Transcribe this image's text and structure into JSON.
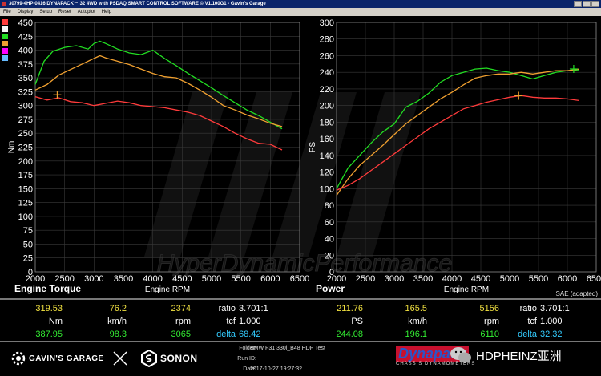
{
  "window": {
    "title": "30799-4HP-0416 DYNAPACK™ 32 4WD with PSDAQ SMART CONTROL SOFTWARE © V1.100G1 - Gavin's Garage",
    "menu": [
      "File",
      "Display",
      "Setup",
      "Reset",
      "Autoplot",
      "Help"
    ]
  },
  "legend_swatches": {
    "colors": [
      "#ff3b3b",
      "#f5f5f5",
      "#22dd22",
      "#f0a030",
      "#ff00ff",
      "#66bbff"
    ]
  },
  "labels": {
    "torque_title": "Engine Torque",
    "power_title": "Power",
    "sae": "SAE (adapted)"
  },
  "watermark": "HyperDynamicPerformance",
  "readout": {
    "torque": {
      "row1": {
        "value": "319.53",
        "speed": "76.2",
        "rpm": "2374"
      },
      "units": {
        "value": "Nm",
        "speed": "km/h",
        "rpm": "rpm"
      },
      "row2": {
        "value": "387.95",
        "speed": "98.3",
        "rpm": "3065"
      }
    },
    "power": {
      "row1": {
        "value": "211.76",
        "speed": "165.5",
        "rpm": "5156"
      },
      "units": {
        "value": "PS",
        "speed": "km/h",
        "rpm": "rpm"
      },
      "row2": {
        "value": "244.08",
        "speed": "196.1",
        "rpm": "6110"
      }
    },
    "torque_info": {
      "ratio_label": "ratio",
      "ratio_value": "3.701:1",
      "tcf_label": "tcf",
      "tcf_value": "1.000",
      "delta_label": "delta",
      "delta_value": "68.42"
    },
    "power_info": {
      "ratio_label": "ratio",
      "ratio_value": "3.701:1",
      "tcf_label": "tcf",
      "tcf_value": "1.000",
      "delta_label": "delta",
      "delta_value": "32.32"
    }
  },
  "footer": {
    "brand1": "GAVIN'S GARAGE",
    "brand2": "SONON",
    "folder_label": "Folder:",
    "folder_value": "BMW F31 330i_B48 HDP Test",
    "runid_label": "Run ID:",
    "runid_value": "",
    "date_label": "Date:",
    "date_value": "2017-10-27 19:27:32",
    "dynapack": "Dynapack",
    "dynapack_sub": "CHASSIS DYNAMOMETERS",
    "wechat": "HDPHEINZ亚洲"
  },
  "chart_data": [
    {
      "type": "line",
      "title": "Engine Torque",
      "xlabel": "Engine RPM",
      "ylabel": "Nm",
      "xlim": [
        2000,
        6500
      ],
      "ylim": [
        0,
        450
      ],
      "xticks": [
        2000,
        2500,
        3000,
        3500,
        4000,
        4500,
        5000,
        5500,
        6000,
        6500
      ],
      "yticks": [
        0,
        25,
        50,
        75,
        100,
        125,
        150,
        175,
        200,
        225,
        250,
        275,
        300,
        325,
        350,
        375,
        400,
        425,
        450
      ],
      "grid": true,
      "series": [
        {
          "color": "#22dd22",
          "x": [
            2000,
            2150,
            2300,
            2500,
            2700,
            2900,
            3000,
            3100,
            3200,
            3400,
            3600,
            3800,
            4000,
            4200,
            4400,
            4600,
            4800,
            5000,
            5200,
            5400,
            5600,
            5800,
            6000,
            6200
          ],
          "y": [
            338,
            380,
            398,
            405,
            408,
            402,
            412,
            416,
            412,
            402,
            395,
            392,
            400,
            385,
            372,
            358,
            345,
            332,
            318,
            305,
            292,
            282,
            270,
            258
          ]
        },
        {
          "color": "#f0a030",
          "x": [
            2000,
            2200,
            2400,
            2600,
            2800,
            3000,
            3100,
            3200,
            3400,
            3600,
            3800,
            4000,
            4200,
            4400,
            4600,
            4800,
            5000,
            5200,
            5400,
            5600,
            5800,
            6000,
            6200
          ],
          "y": [
            328,
            338,
            355,
            365,
            375,
            385,
            390,
            386,
            380,
            374,
            366,
            358,
            352,
            350,
            340,
            328,
            315,
            300,
            292,
            283,
            276,
            268,
            262
          ]
        },
        {
          "color": "#ff3b3b",
          "x": [
            2000,
            2200,
            2400,
            2600,
            2800,
            3000,
            3200,
            3400,
            3600,
            3800,
            4000,
            4200,
            4400,
            4600,
            4800,
            5000,
            5200,
            5400,
            5600,
            5800,
            6000,
            6200
          ],
          "y": [
            316,
            310,
            314,
            307,
            305,
            300,
            304,
            308,
            305,
            300,
            298,
            296,
            292,
            288,
            282,
            272,
            262,
            250,
            240,
            232,
            230,
            220
          ]
        }
      ],
      "markers": [
        {
          "x": 2374,
          "y": 319.53,
          "color": "#f0a030"
        }
      ]
    },
    {
      "type": "line",
      "title": "Power",
      "xlabel": "Engine RPM",
      "ylabel": "PS",
      "xlim": [
        2000,
        6500
      ],
      "ylim": [
        0,
        300
      ],
      "xticks": [
        2000,
        2500,
        3000,
        3500,
        4000,
        4500,
        5000,
        5500,
        6000,
        6500
      ],
      "yticks": [
        0,
        20,
        40,
        60,
        80,
        100,
        120,
        140,
        160,
        180,
        200,
        220,
        240,
        260,
        280,
        300
      ],
      "grid": true,
      "series": [
        {
          "color": "#22dd22",
          "x": [
            2000,
            2200,
            2400,
            2600,
            2800,
            3000,
            3200,
            3400,
            3600,
            3800,
            4000,
            4200,
            4400,
            4600,
            4800,
            5000,
            5200,
            5400,
            5600,
            5800,
            6000,
            6200
          ],
          "y": [
            100,
            125,
            140,
            155,
            168,
            178,
            198,
            205,
            215,
            228,
            236,
            240,
            244,
            245,
            242,
            240,
            236,
            232,
            236,
            240,
            242,
            243
          ]
        },
        {
          "color": "#f0a030",
          "x": [
            2000,
            2200,
            2400,
            2600,
            2800,
            3000,
            3200,
            3400,
            3600,
            3800,
            4000,
            4200,
            4400,
            4600,
            4800,
            5000,
            5200,
            5400,
            5600,
            5800,
            6000,
            6200
          ],
          "y": [
            92,
            112,
            128,
            140,
            152,
            165,
            178,
            188,
            198,
            208,
            216,
            225,
            233,
            236,
            238,
            238,
            240,
            238,
            240,
            242,
            242,
            244
          ]
        },
        {
          "color": "#ff3b3b",
          "x": [
            2000,
            2200,
            2400,
            2600,
            2800,
            3000,
            3200,
            3400,
            3600,
            3800,
            4000,
            4200,
            4400,
            4600,
            4800,
            5000,
            5200,
            5400,
            5600,
            5800,
            6000,
            6200
          ],
          "y": [
            98,
            104,
            112,
            122,
            132,
            142,
            152,
            162,
            172,
            180,
            188,
            196,
            200,
            204,
            207,
            210,
            212,
            210,
            209,
            209,
            208,
            206
          ]
        }
      ],
      "markers": [
        {
          "x": 5156,
          "y": 211.76,
          "color": "#f0a030"
        },
        {
          "x": 6110,
          "y": 244.08,
          "color": "#22dd22"
        }
      ]
    }
  ]
}
